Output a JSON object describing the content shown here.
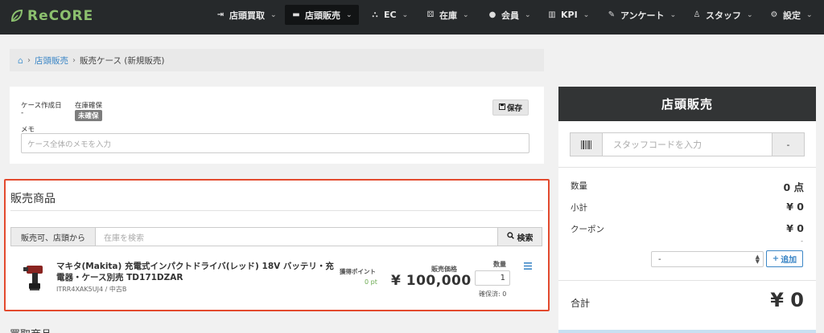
{
  "app": {
    "logo_text": "ReCORE"
  },
  "nav": {
    "items": [
      {
        "label": "店頭買取",
        "icon": "sign-in-icon",
        "glyph": "⇥"
      },
      {
        "label": "店頭販売",
        "icon": "cart-icon",
        "glyph": "🛒"
      },
      {
        "label": "EC",
        "icon": "sitemap-icon",
        "glyph": "⛬"
      },
      {
        "label": "在庫",
        "icon": "cubes-icon",
        "glyph": "⚄"
      },
      {
        "label": "会員",
        "icon": "user-icon",
        "glyph": "●"
      },
      {
        "label": "KPI",
        "icon": "bar-chart-icon",
        "glyph": "▥"
      },
      {
        "label": "アンケート",
        "icon": "edit-icon",
        "glyph": "✎"
      },
      {
        "label": "スタッフ",
        "icon": "user-outline-icon",
        "glyph": "♙"
      },
      {
        "label": "設定",
        "icon": "gear-icon",
        "glyph": "⚙"
      }
    ],
    "caret": "⌄"
  },
  "breadcrumb": {
    "home_icon": "⌂",
    "link": "店頭販売",
    "current": "販売ケース (新規販売)",
    "sep": "›"
  },
  "case": {
    "created_label": "ケース作成日",
    "created_value": "-",
    "reserve_label": "在庫確保",
    "reserve_badge": "未確保",
    "save_label": "保存",
    "save_icon": "💾",
    "memo_label": "メモ",
    "memo_placeholder": "ケース全体のメモを入力"
  },
  "products": {
    "title": "販売商品",
    "filter_label": "販売可、店頭から",
    "search_placeholder": "在庫を検索",
    "search_button": "検索",
    "search_icon": "⚲",
    "items": [
      {
        "name": "マキタ(Makita) 充電式インパクトドライバ(レッド) 18V バッテリ・充電器・ケース別売 TD171DZAR",
        "code": "ITRR4XAK5UJ4 / 中古B",
        "points_label": "獲得ポイント",
        "points_value": "0 pt",
        "price_label": "販売価格",
        "price_value": "¥ 100,000",
        "qty_label": "数量",
        "qty_value": "1",
        "reserved": "確保済: 0"
      }
    ],
    "next_section_title": "買取商品"
  },
  "sidebar": {
    "title": "店頭販売",
    "staff_placeholder": "スタッフコードを入力",
    "staff_button": "-",
    "qty_label": "数量",
    "qty_value": "0 点",
    "subtotal_label": "小計",
    "subtotal_value": "¥ 0",
    "coupon_label": "クーポン",
    "coupon_value": "¥ 0",
    "coupon_note": "-",
    "coupon_select": "-",
    "add_button": "追加",
    "total_label": "合計",
    "total_value": "¥ 0"
  },
  "colors": {
    "accent_green": "#8cc06e",
    "link_blue": "#3b86c6",
    "highlight_red": "#e34a2e",
    "nav_bg": "#26292b"
  }
}
